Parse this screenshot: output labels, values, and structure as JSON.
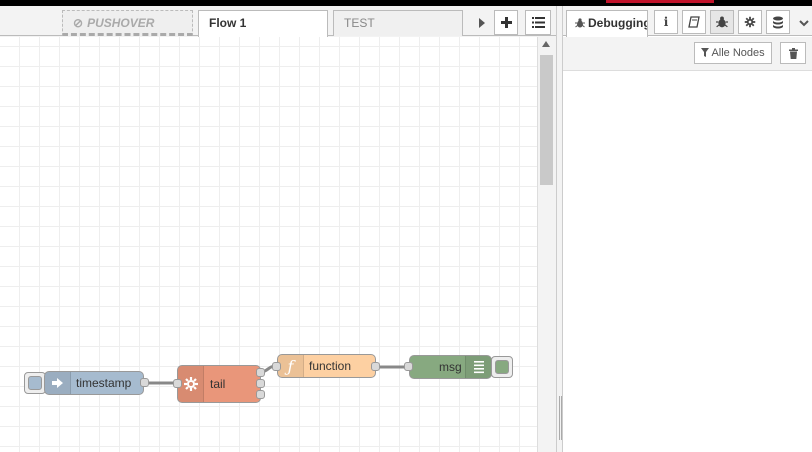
{
  "workspace": {
    "tabs": [
      {
        "label": "PUSHOVER",
        "state": "disabled"
      },
      {
        "label": "Flow 1",
        "state": "active"
      },
      {
        "label": "TEST",
        "state": "inactive"
      }
    ],
    "tab_buttons": [
      "scroll-right",
      "add-flow",
      "list-flows"
    ]
  },
  "sidebar": {
    "active_tab_label": "Debugging",
    "icon_tabs": [
      "info-icon",
      "book-icon",
      "bug-icon",
      "gear-icon",
      "database-icon"
    ],
    "filter_label": "Alle Nodes",
    "more_icon": "chevron-down-icon"
  },
  "nodes": {
    "timestamp": {
      "label": "timestamp",
      "color": "#a6bbcf"
    },
    "tail": {
      "label": "tail",
      "color": "#e9967a"
    },
    "function": {
      "label": "function",
      "color": "#fdd0a2"
    },
    "msg": {
      "label": "msg",
      "color": "#87a980"
    }
  },
  "colors": {
    "accent": "#c0122a",
    "grid": "#eeeeee"
  }
}
